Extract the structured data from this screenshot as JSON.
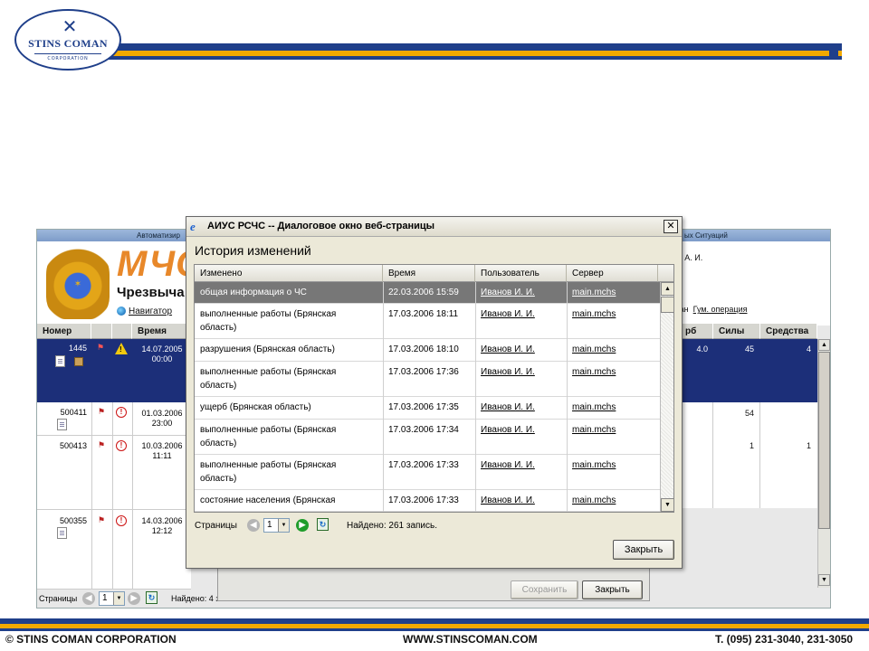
{
  "slide": {
    "logo": {
      "mark": "✕",
      "name": "STINS COMAN",
      "sub": "CORPORATION"
    },
    "footer": {
      "company": "© STINS COMAN CORPORATION",
      "website": "WWW.STINSCOMAN.COM",
      "phone": "T. (095) 231-3040, 231-3050"
    }
  },
  "bg_app": {
    "title_left": "Автоматизир",
    "title_right": "ых Ситуаций",
    "logo_text": "МЧС",
    "subtitle": "Чрезвыча",
    "nav_link": "Навигатор",
    "user": "в А. И.",
    "links": [
      "ван",
      "Гум. операция"
    ],
    "table_headers": [
      "Номер",
      "Время"
    ],
    "right_headers": [
      "рб",
      "Силы",
      "Средства"
    ],
    "rows": [
      {
        "num": "1445",
        "time": "14.07.2005\n00:00",
        "rb": "4.0",
        "forces": "45",
        "means": "4"
      },
      {
        "num": "500411",
        "time": "01.03.2006\n23:00",
        "rb": "",
        "forces": "54",
        "means": ""
      },
      {
        "num": "500413",
        "time": "10.03.2006\n11:11",
        "rb": "",
        "forces": "1",
        "means": "1"
      },
      {
        "num": "500355",
        "time": "14.03.2006\n12:12",
        "rb": "",
        "forces": "",
        "means": ""
      }
    ],
    "pager": {
      "label": "Страницы",
      "page": "1",
      "found": "Найдено: 4 з"
    },
    "inner_buttons": {
      "save": "Сохранить",
      "close": "Закрыть"
    }
  },
  "dialog": {
    "title": "АИУС РСЧС -- Диалоговое окно веб-страницы",
    "heading": "История изменений",
    "columns": [
      "Изменено",
      "Время",
      "Пользователь",
      "Сервер"
    ],
    "rows": [
      {
        "changed": "общая информация о ЧС",
        "time": "22.03.2006 15:59",
        "user": "Иванов И. И.",
        "server": "main.mchs",
        "selected": true
      },
      {
        "changed": "выполненные работы (Брянская\nобласть)",
        "time": "17.03.2006 18:11",
        "user": "Иванов И. И.",
        "server": "main.mchs"
      },
      {
        "changed": "разрушения (Брянская область)",
        "time": "17.03.2006 18:10",
        "user": "Иванов И. И.",
        "server": "main.mchs"
      },
      {
        "changed": "выполненные работы (Брянская\nобласть)",
        "time": "17.03.2006 17:36",
        "user": "Иванов И. И.",
        "server": "main.mchs"
      },
      {
        "changed": "ущерб (Брянская область)",
        "time": "17.03.2006 17:35",
        "user": "Иванов И. И.",
        "server": "main.mchs"
      },
      {
        "changed": "выполненные работы (Брянская\nобласть)",
        "time": "17.03.2006 17:34",
        "user": "Иванов И. И.",
        "server": "main.mchs"
      },
      {
        "changed": "выполненные работы (Брянская\nобласть)",
        "time": "17.03.2006 17:33",
        "user": "Иванов И. И.",
        "server": "main.mchs"
      },
      {
        "changed": "состояние населения (Брянская",
        "time": "17.03.2006 17:33",
        "user": "Иванов И. И.",
        "server": "main.mchs"
      }
    ],
    "pager": {
      "label": "Страницы",
      "page": "1",
      "found": "Найдено: 261 запись."
    },
    "close_button": "Закрыть"
  },
  "colors": {
    "brand_blue": "#1f3f8a",
    "brand_orange": "#f2a900",
    "selection": "#1c2f79"
  }
}
